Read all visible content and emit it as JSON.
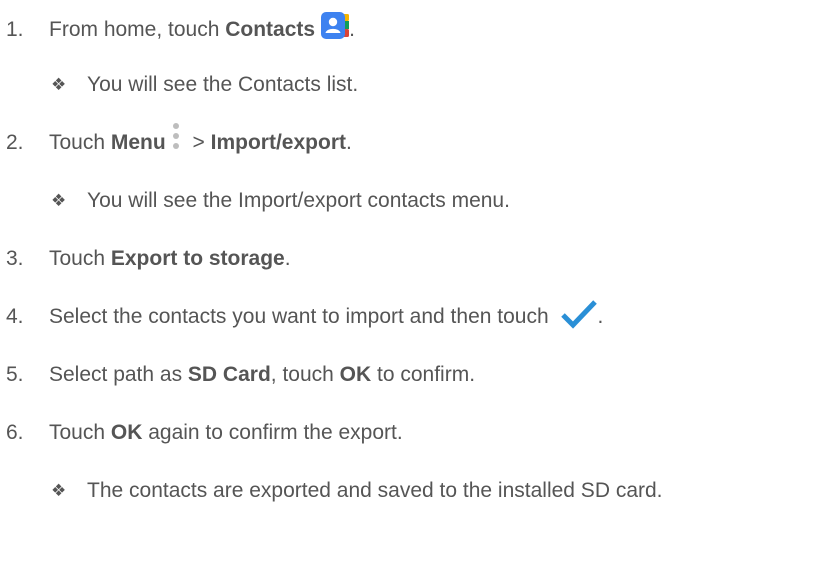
{
  "steps": [
    {
      "number": "1.",
      "pre": "From home, touch ",
      "bold": "Contacts",
      "post": ".",
      "icon": "contacts-app-icon"
    },
    {
      "bullet": "You will see the Contacts list."
    },
    {
      "number": "2.",
      "pre": "Touch ",
      "bold": "Menu",
      "icon": "menu-dots-icon",
      "mid": " > ",
      "bold2": "Import/export",
      "post": "."
    },
    {
      "bullet": "You will see the Import/export contacts menu."
    },
    {
      "number": "3.",
      "pre": "Touch ",
      "bold": "Export to storage",
      "post": "."
    },
    {
      "number": "4.",
      "pre": "Select the contacts you want to import and then touch ",
      "icon": "checkmark-icon",
      "post": "."
    },
    {
      "number": "5.",
      "pre": "Select path as ",
      "bold": "SD Card",
      "mid": ", touch ",
      "bold2": "OK",
      "post": " to confirm."
    },
    {
      "number": "6.",
      "pre": "Touch ",
      "bold": "OK",
      "post": " again to confirm the export."
    },
    {
      "bullet": "The contacts are exported and saved to the installed SD card."
    }
  ],
  "bullet_glyph": "❖",
  "colors": {
    "text": "#555555",
    "check_blue": "#2a8fd6",
    "contacts_blue": "#3d82f0"
  }
}
